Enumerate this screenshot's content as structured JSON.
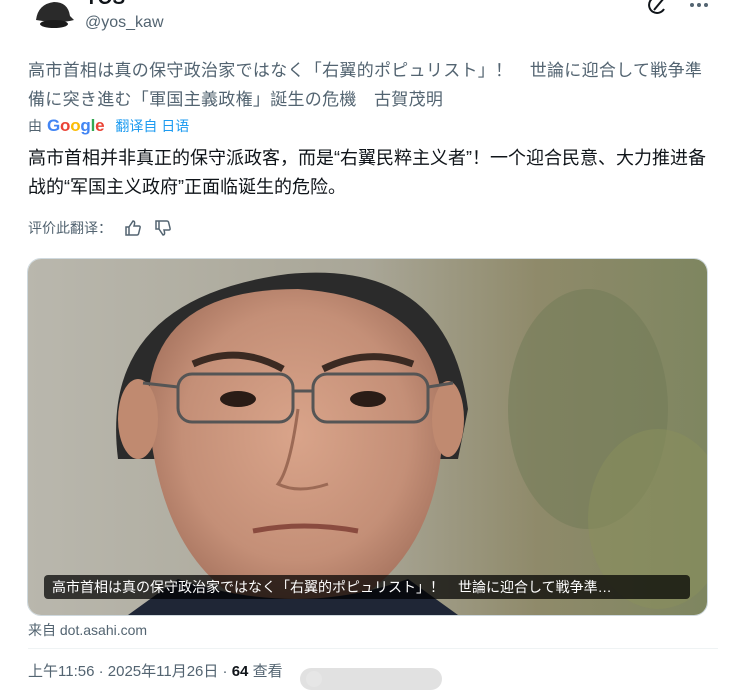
{
  "author": {
    "display_name": "YOS",
    "handle": "@yos_kaw"
  },
  "original_text": "高市首相は真の保守政治家ではなく「右翼的ポピュリスト」！　世論に迎合して戦争準備に突き進む「軍国主義政権」誕生の危機　古賀茂明",
  "translation": {
    "prefix": "由",
    "provider": "Google",
    "link_label": "翻译自 日语",
    "text": "高市首相并非真正的保守派政客，而是“右翼民粹主义者”！一个迎合民意、大力推进备战的“军国主义政府”正面临诞生的危险。",
    "rate_label": "评价此翻译："
  },
  "card": {
    "caption": "高市首相は真の保守政治家ではなく「右翼的ポピュリスト」！　世論に迎合して戦争準…",
    "source": "来自 dot.asahi.com"
  },
  "meta": {
    "time": "上午11:56 · 2025年11月26日 · ",
    "views": "64",
    "views_label": "查看"
  },
  "icons": [
    "grok-icon",
    "more-icon",
    "thumbs-up-icon",
    "thumbs-down-icon"
  ],
  "colors": {
    "link": "#1d9bf0",
    "secondary": "#536471",
    "primary": "#0f1419"
  }
}
